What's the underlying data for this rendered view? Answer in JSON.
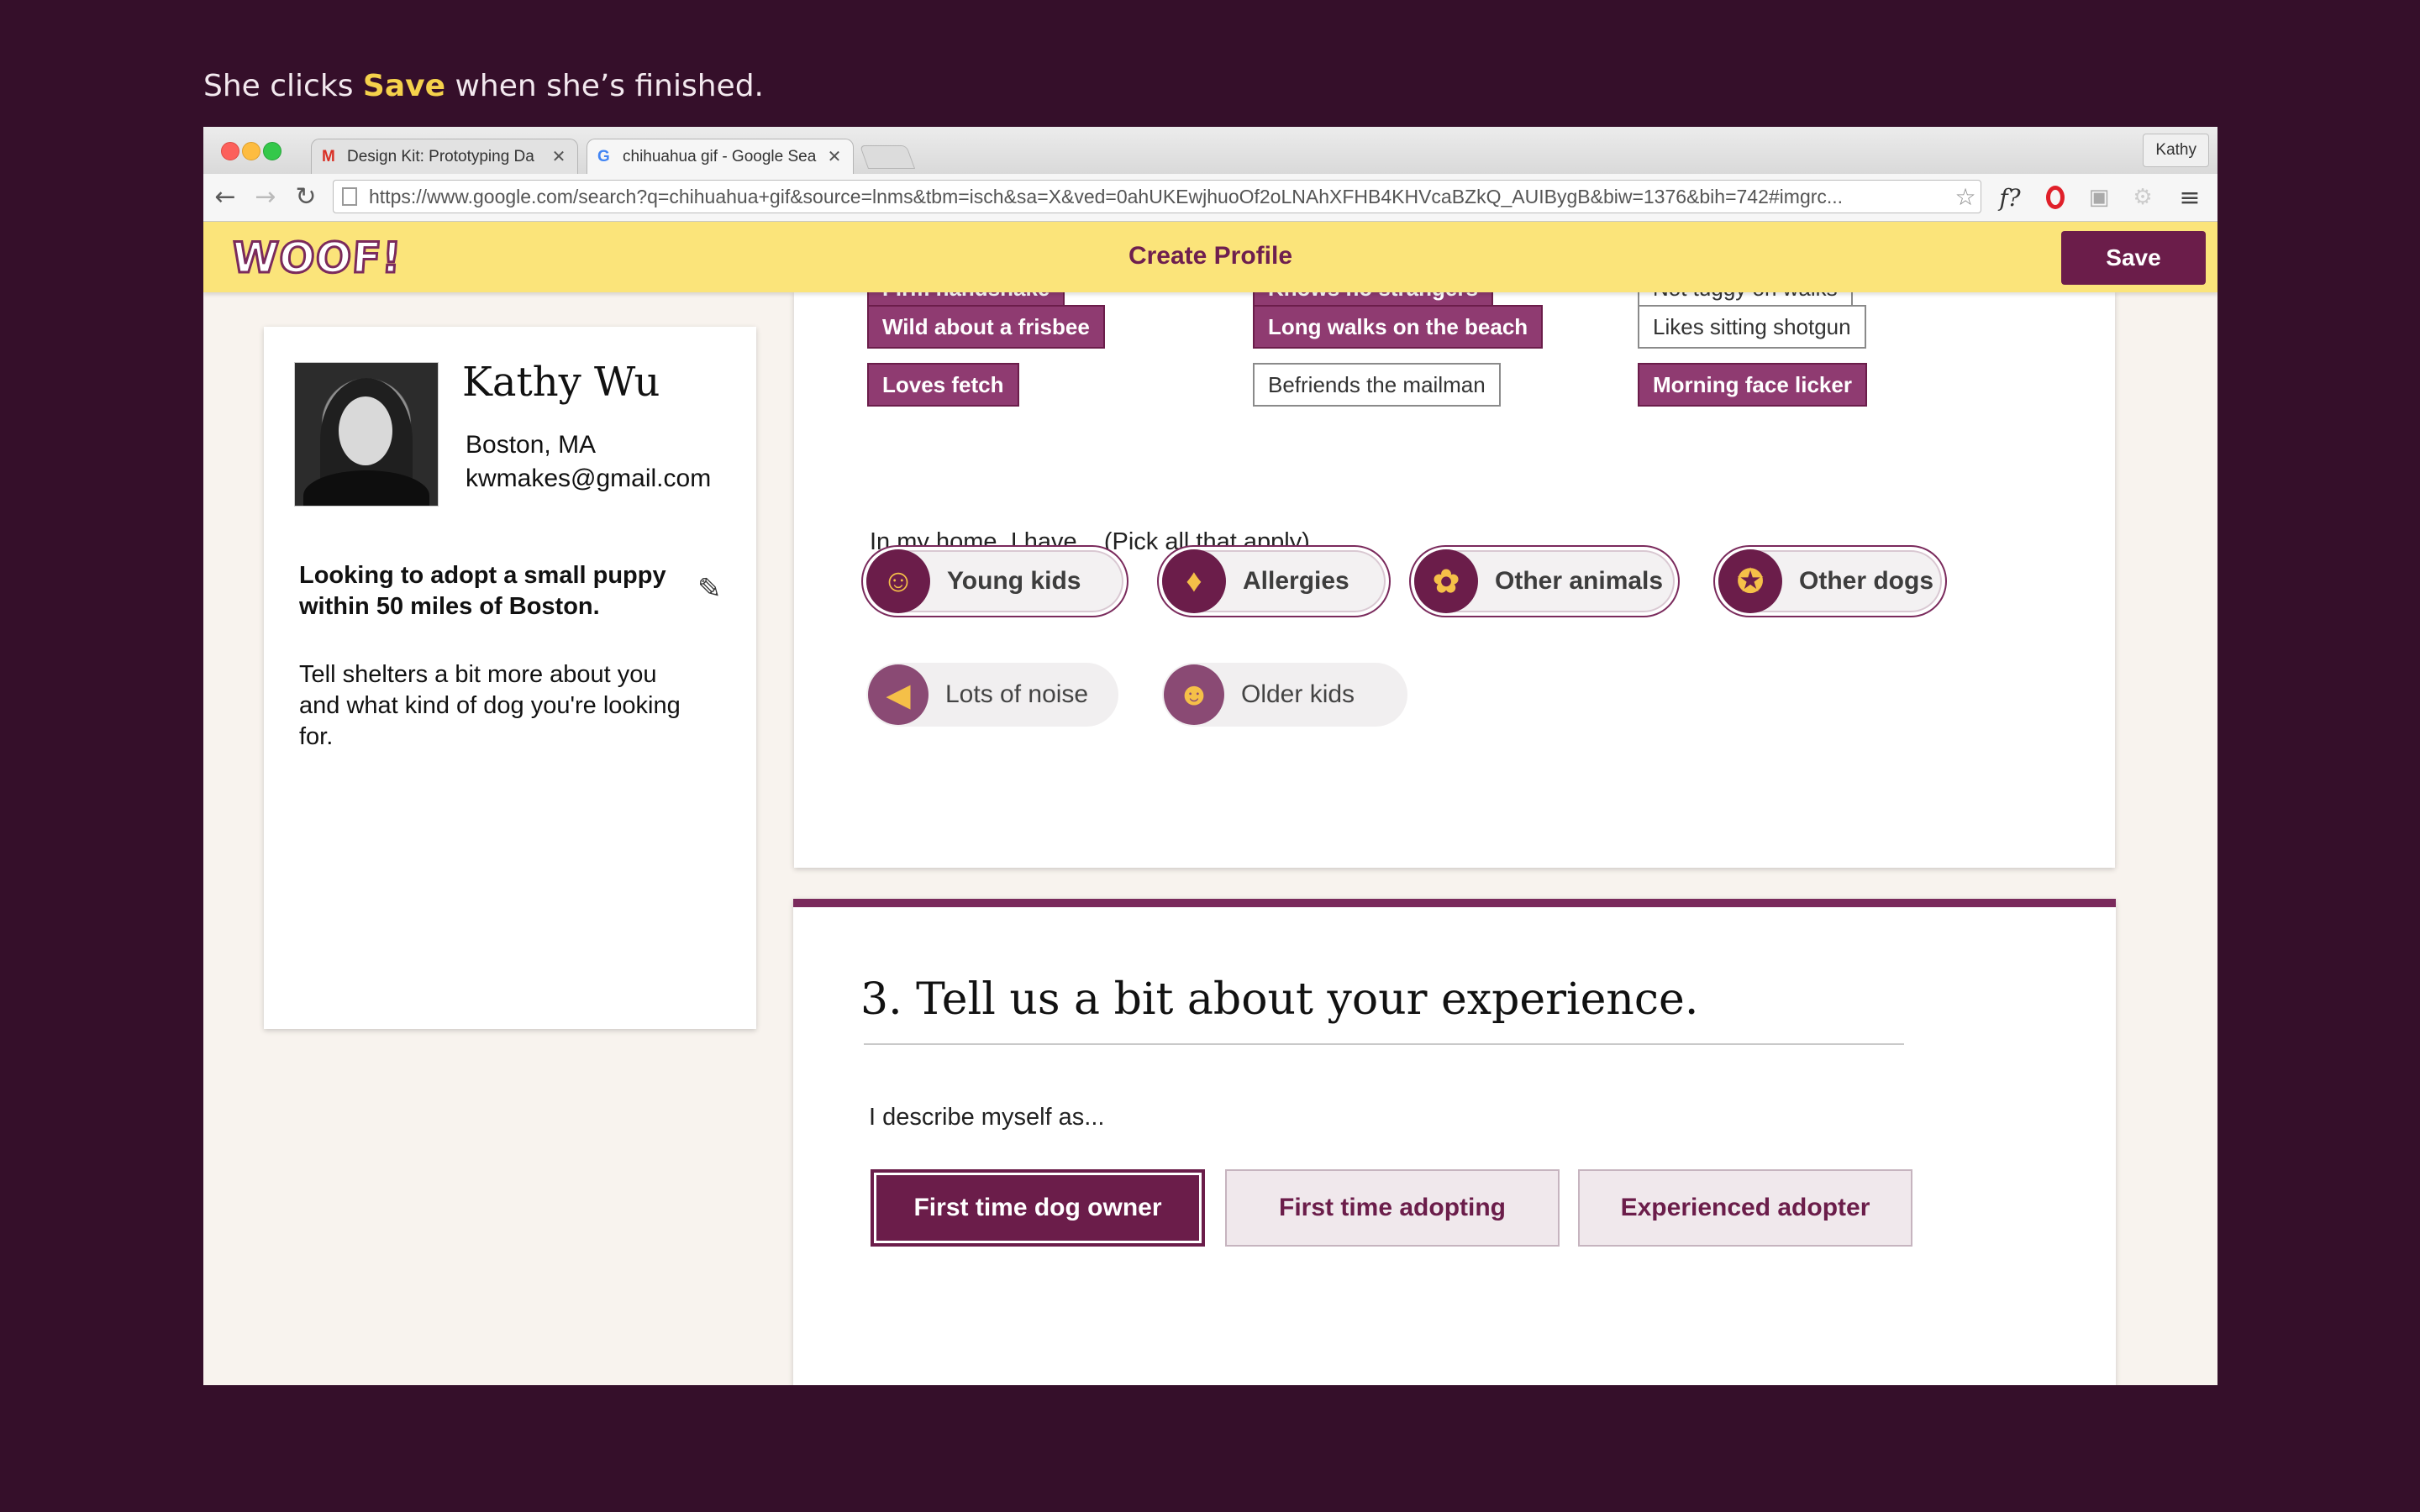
{
  "caption": {
    "prefix": "She clicks ",
    "highlight": "Save",
    "suffix": " when she’s finished."
  },
  "browser": {
    "tabs": [
      {
        "favicon": "gmail-icon",
        "title": "Design Kit: Prototyping Da",
        "active": false
      },
      {
        "favicon": "google-icon",
        "title": "chihuahua gif - Google Sea",
        "active": true
      }
    ],
    "profile_button": "Kathy",
    "url": "https://www.google.com/search?q=chihuahua+gif&source=lnms&tbm=isch&sa=X&ved=0ahUKEwjhuoOf2oLNAhXFHB4KHVcaBZkQ_AUIBygB&biw=1376&bih=742#imgrc...",
    "ext_font": "f?"
  },
  "app": {
    "logo": "WOOF!",
    "title": "Create Profile",
    "save_label": "Save"
  },
  "profile": {
    "name": "Kathy Wu",
    "city": "Boston, MA",
    "email": "kwmakes@gmail.com",
    "goal": "Looking to adopt a small puppy within 50 miles of Boston.",
    "hint": "Tell shelters a bit more about you and what kind of dog you're looking for."
  },
  "traits": [
    {
      "label": "Firm handshake",
      "selected": true
    },
    {
      "label": "Knows no strangers",
      "selected": true
    },
    {
      "label": "Not tuggy on walks",
      "selected": false
    },
    {
      "label": "Wild about a frisbee",
      "selected": true
    },
    {
      "label": "Long walks on the beach",
      "selected": true
    },
    {
      "label": "Likes sitting shotgun",
      "selected": false
    },
    {
      "label": "Loves fetch",
      "selected": true
    },
    {
      "label": "Befriends the mailman",
      "selected": false
    },
    {
      "label": "Morning face licker",
      "selected": true
    }
  ],
  "home": {
    "question": "In my home, I have... (Pick all that apply)",
    "options": [
      {
        "label": "Young kids",
        "icon": "baby-icon",
        "glyph": "☺",
        "selected": true
      },
      {
        "label": "Allergies",
        "icon": "nose-icon",
        "glyph": "♦",
        "selected": true
      },
      {
        "label": "Other animals",
        "icon": "hamster-icon",
        "glyph": "✿",
        "selected": true
      },
      {
        "label": "Other dogs",
        "icon": "dog-icon",
        "glyph": "✪",
        "selected": true
      },
      {
        "label": "Lots of noise",
        "icon": "megaphone-icon",
        "glyph": "◀",
        "selected": false
      },
      {
        "label": "Older kids",
        "icon": "child-icon",
        "glyph": "☻",
        "selected": false
      }
    ]
  },
  "experience": {
    "title": "3. Tell us a bit about your experience.",
    "question": "I describe myself as...",
    "options": [
      {
        "label": "First time dog owner",
        "selected": true
      },
      {
        "label": "First time adopting",
        "selected": false
      },
      {
        "label": "Experienced adopter",
        "selected": false
      }
    ]
  },
  "colors": {
    "accent": "#6b1d4a",
    "header": "#fbe47a",
    "background": "#350f2a",
    "highlight": "#f5d24b"
  }
}
